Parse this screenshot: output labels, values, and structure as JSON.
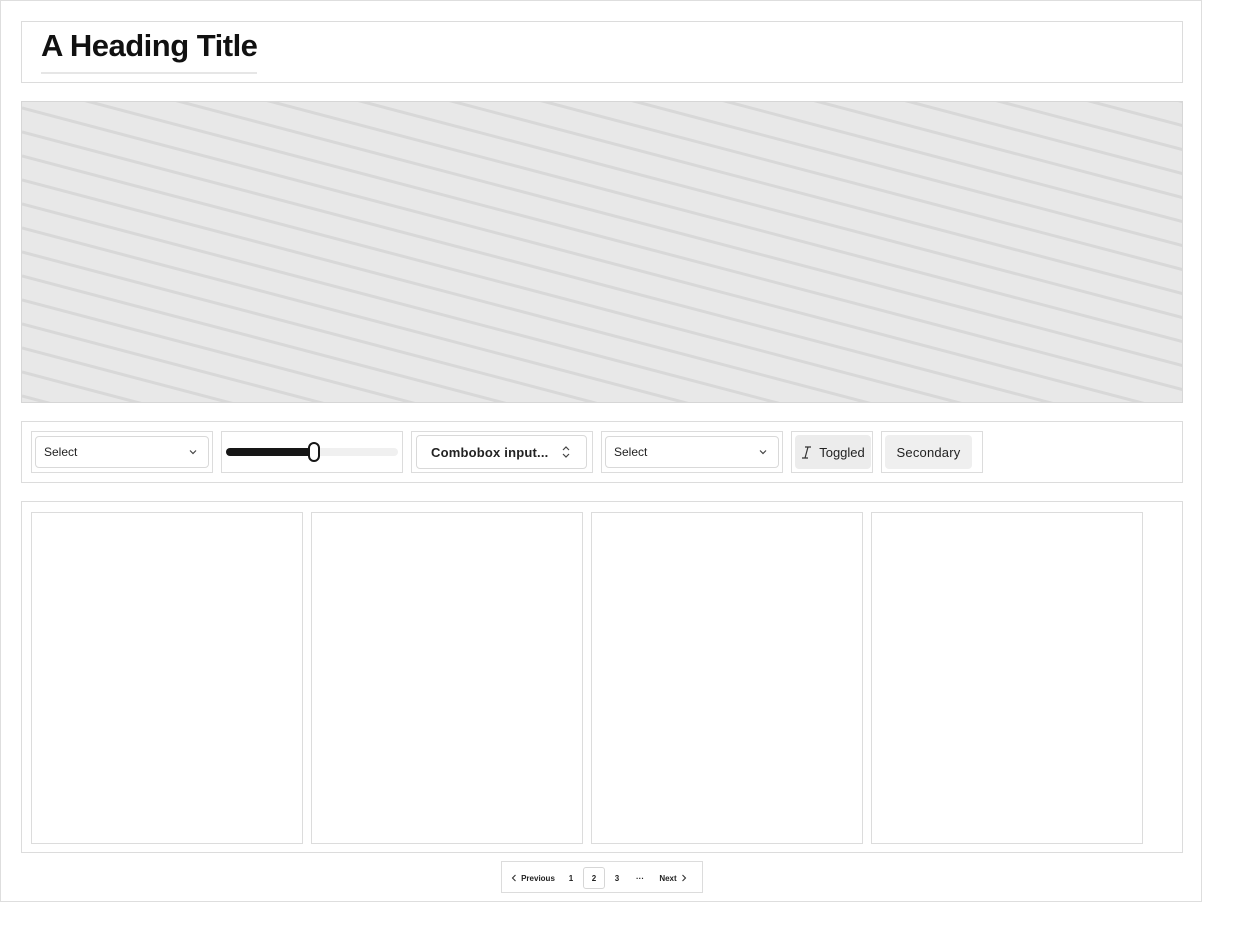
{
  "header": {
    "title": "A Heading Title"
  },
  "toolbar": {
    "select_1": {
      "value": "Select",
      "icon": "chevron-down-icon"
    },
    "slider": {
      "value_percent": 50
    },
    "combobox": {
      "value": "Combobox input...",
      "icon": "chevron-up-down-icon"
    },
    "select_2": {
      "value": "Select",
      "icon": "chevron-down-icon"
    },
    "toggle": {
      "label": "Toggled",
      "icon": "italic-icon",
      "pressed": true
    },
    "secondary": {
      "label": "Secondary"
    }
  },
  "cards": {
    "count": 4
  },
  "pagination": {
    "previous_label": "Previous",
    "next_label": "Next",
    "pages": [
      "1",
      "2",
      "3"
    ],
    "current_page": "2",
    "ellipsis": "···"
  },
  "colors": {
    "text": "#111111",
    "accent": "#161616",
    "border": "#dcdcdc",
    "placeholder_bg": "#e8e8e8"
  }
}
